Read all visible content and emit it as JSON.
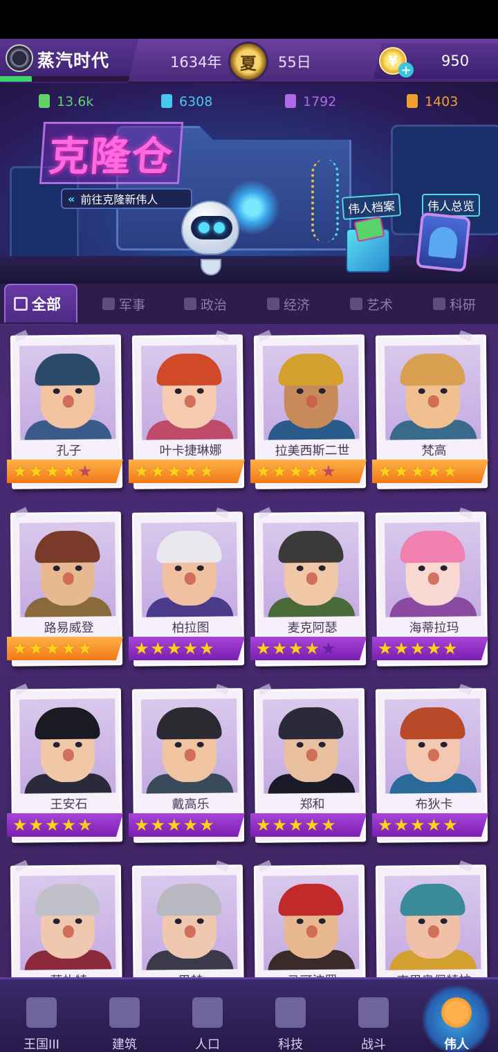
{
  "topbar": {
    "era_name": "蒸汽时代",
    "era_progress": 0.24,
    "year": "1634年",
    "season": "夏",
    "day": "55日",
    "gold": "950"
  },
  "resources": [
    {
      "value": "13.6k",
      "color": "#5fd36a",
      "icon": "green-resource-icon"
    },
    {
      "value": "6308",
      "color": "#46c8f0",
      "icon": "blue-resource-icon"
    },
    {
      "value": "1792",
      "color": "#b06ae8",
      "icon": "purple-resource-icon"
    },
    {
      "value": "1403",
      "color": "#f0a030",
      "icon": "orange-resource-icon"
    }
  ],
  "banner": {
    "title": "克隆仓",
    "subtitle": "前往克隆新伟人",
    "archive_label": "伟人档案",
    "overview_label": "伟人总览"
  },
  "tabs": [
    {
      "label": "全部",
      "active": true
    },
    {
      "label": "军事",
      "active": false
    },
    {
      "label": "政治",
      "active": false
    },
    {
      "label": "经济",
      "active": false
    },
    {
      "label": "艺术",
      "active": false
    },
    {
      "label": "科研",
      "active": false
    }
  ],
  "greats": [
    {
      "name": "孔子",
      "stars": 3.5,
      "frame": "orange",
      "skin": "#f1c3a0",
      "hair": "#2a4a6a",
      "body": "#3a5a8a",
      "bg": "#d9c8ec"
    },
    {
      "name": "叶卡捷琳娜",
      "stars": 4.5,
      "frame": "orange",
      "skin": "#f6cbb0",
      "hair": "#d04a2a",
      "body": "#c04a6a",
      "bg": "#d9c8ec"
    },
    {
      "name": "拉美西斯二世",
      "stars": 3.5,
      "frame": "orange",
      "skin": "#c98a5a",
      "hair": "#d4a030",
      "body": "#2a5a8a",
      "bg": "#d9c8ec"
    },
    {
      "name": "梵高",
      "stars": 4.5,
      "frame": "orange",
      "skin": "#f0c090",
      "hair": "#d8a050",
      "body": "#3a6a8a",
      "bg": "#d9c8ec"
    },
    {
      "name": "路易威登",
      "stars": 4.5,
      "frame": "orange",
      "skin": "#e8b890",
      "hair": "#7a3a2a",
      "body": "#8a6a3a",
      "bg": "#d9c8ec"
    },
    {
      "name": "柏拉图",
      "stars": 5,
      "frame": "purple",
      "skin": "#f0c0a0",
      "hair": "#e8e8ee",
      "body": "#4a3a8a",
      "bg": "#d9c8ec"
    },
    {
      "name": "麦克阿瑟",
      "stars": 3.5,
      "frame": "purple",
      "skin": "#f0c8a8",
      "hair": "#3a3a3a",
      "body": "#4a6a3a",
      "bg": "#d9c8ec"
    },
    {
      "name": "海蒂拉玛",
      "stars": 5,
      "frame": "purple",
      "skin": "#f8d8d0",
      "hair": "#f080b0",
      "body": "#8a4aa0",
      "bg": "#d9c8ec"
    },
    {
      "name": "王安石",
      "stars": 4.5,
      "frame": "purple",
      "skin": "#f0c8a8",
      "hair": "#1a1a22",
      "body": "#2a2a3a",
      "bg": "#d9c8ec"
    },
    {
      "name": "戴高乐",
      "stars": 5,
      "frame": "purple",
      "skin": "#f0c4a0",
      "hair": "#2a2a30",
      "body": "#3a4a5a",
      "bg": "#d9c8ec"
    },
    {
      "name": "郑和",
      "stars": 4.5,
      "frame": "purple",
      "skin": "#e8c0a0",
      "hair": "#2a2a3a",
      "body": "#1a1a28",
      "bg": "#d9c8ec"
    },
    {
      "name": "布狄卡",
      "stars": 5,
      "frame": "purple",
      "skin": "#f4c8b0",
      "hair": "#b84a2a",
      "body": "#2a6a9a",
      "bg": "#d9c8ec"
    },
    {
      "name": "莫扎特",
      "stars": 0,
      "frame": "none",
      "skin": "#f0c8b0",
      "hair": "#c0c0c8",
      "body": "#8a2a3a",
      "bg": "#d9c8ec"
    },
    {
      "name": "巴赫",
      "stars": 0,
      "frame": "none",
      "skin": "#f0c8b0",
      "hair": "#b8b8c0",
      "body": "#3a3a4a",
      "bg": "#d9c8ec"
    },
    {
      "name": "马可波罗",
      "stars": 0,
      "frame": "none",
      "skin": "#e8b890",
      "hair": "#c02a2a",
      "body": "#3a2a2a",
      "bg": "#d9c8ec"
    },
    {
      "name": "克里奥佩特拉",
      "stars": 0,
      "frame": "none",
      "skin": "#f0c0a8",
      "hair": "#3a8a9a",
      "body": "#d4a030",
      "bg": "#d9c8ec"
    }
  ],
  "bottomnav": [
    {
      "label": "王国III",
      "icon": "castle-icon",
      "active": false
    },
    {
      "label": "建筑",
      "icon": "house-icon",
      "active": false
    },
    {
      "label": "人口",
      "icon": "person-icon",
      "active": false
    },
    {
      "label": "科技",
      "icon": "book-icon",
      "active": false
    },
    {
      "label": "战斗",
      "icon": "crossed-swords-icon",
      "active": false
    },
    {
      "label": "伟人",
      "icon": "statue-icon",
      "active": true
    }
  ]
}
